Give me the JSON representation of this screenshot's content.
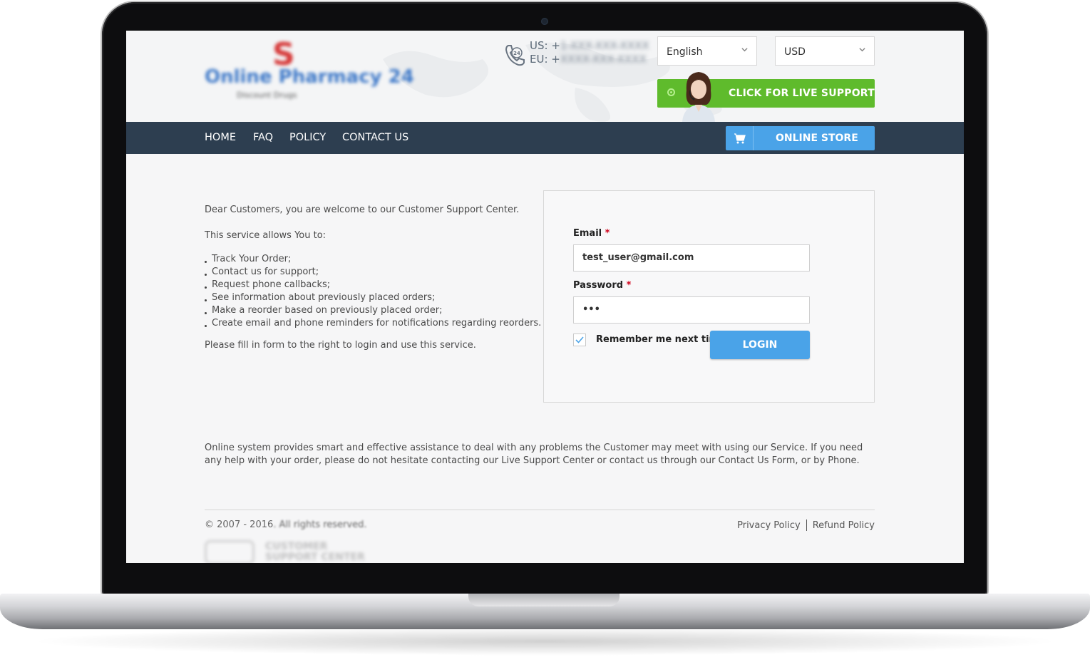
{
  "header": {
    "logo_text": "Online Pharmacy 24",
    "logo_mark": "S",
    "logo_subtitle": "Discount Drugs",
    "phone_us_prefix": "US: +",
    "phone_us_number": "1-XXX-XXX-XXXX",
    "phone_eu_prefix": "EU: +",
    "phone_eu_number": "XXXX-XXX-XXXX",
    "language": "English",
    "currency": "USD",
    "live_support_label": "CLICK FOR LIVE SUPPORT"
  },
  "nav": {
    "items": [
      "HOME",
      "FAQ",
      "POLICY",
      "CONTACT US"
    ],
    "store_label": "ONLINE STORE"
  },
  "intro": {
    "welcome": "Dear Customers, you are welcome to our Customer Support Center.",
    "allows": "This service allows You to:",
    "bullets": [
      "Track Your Order;",
      "Contact us for support;",
      "Request phone callbacks;",
      "See information about previously placed orders;",
      "Make a reorder based on previously placed order;",
      "Create email and phone reminders for notifications regarding reorders."
    ],
    "instruction": "Please fill in form to the right to login and use this service."
  },
  "login": {
    "email_label": "Email",
    "email_value": "test_user@gmail.com",
    "password_label": "Password",
    "password_value": "•••",
    "required_mark": "*",
    "remember_label": "Remember me next time",
    "remember_checked": true,
    "login_button": "LOGIN"
  },
  "bottom_text": "Online system provides smart and effective assistance to deal with any problems the Customer may meet with using our Service. If you need any help with your order, please do not hesitate contacting our Live Support Center or contact us through our Contact Us Form, or by Phone.",
  "footer": {
    "copyright_start": "© 2007 - 2016",
    "copyright_rest": ". All rights reserved.",
    "privacy_policy": "Privacy Policy",
    "refund_policy": "Refund Policy",
    "csc_logo_text_1": "CUSTOMER",
    "csc_logo_text_2": "SUPPORT CENTER"
  },
  "colors": {
    "nav_bg": "#2d3e50",
    "live_green": "#5fbb2c",
    "accent_blue": "#4aa3e8",
    "required_red": "#d0021b"
  },
  "icons": [
    "phone-24-icon",
    "chevron-down-icon",
    "live-dot-icon",
    "cart-icon",
    "checkmark-icon"
  ]
}
